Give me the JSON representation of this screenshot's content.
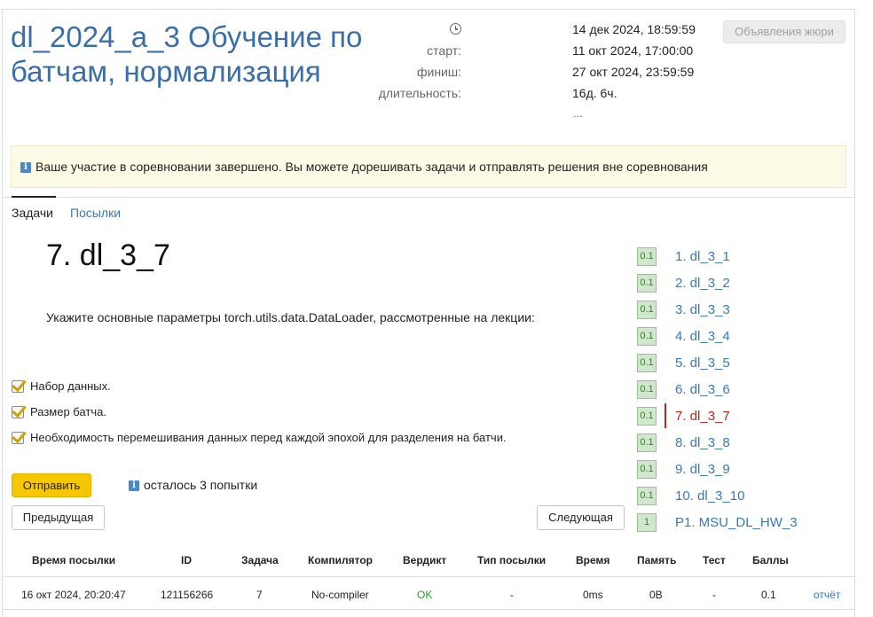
{
  "contest": {
    "title": "dl_2024_a_3 Обучение по батчам, нормализация",
    "jury_button": "Объявления жюри",
    "now": "14 дек 2024, 18:59:59",
    "start_label": "старт:",
    "start": "11 окт 2024, 17:00:00",
    "finish_label": "финиш:",
    "finish": "27 окт 2024, 23:59:59",
    "duration_label": "длительность:",
    "duration": "16д. 6ч.",
    "more": "..."
  },
  "notice": {
    "text": "Ваше участие в соревновании завершено. Вы можете дорешивать задачи и отправлять решения вне соревнования"
  },
  "tabs": [
    {
      "label": "Задачи",
      "active": true
    },
    {
      "label": "Посылки",
      "active": false
    }
  ],
  "problem": {
    "title": "7. dl_3_7",
    "statement": "Укажите основные параметры torch.utils.data.DataLoader, рассмотренные на лекции:",
    "options": [
      {
        "label": "Набор данных.",
        "checked": true
      },
      {
        "label": "Размер батча.",
        "checked": true
      },
      {
        "label": "Необходимость перемешивания данных перед каждой эпохой для разделения на батчи.",
        "checked": true
      }
    ],
    "submit_label": "Отправить",
    "attempts_text": "осталось 3 попытки",
    "prev_label": "Предыдущая",
    "next_label": "Следующая"
  },
  "tasks": [
    {
      "badge": "0.1",
      "label": "1. dl_3_1"
    },
    {
      "badge": "0.1",
      "label": "2. dl_3_2"
    },
    {
      "badge": "0.1",
      "label": "3. dl_3_3"
    },
    {
      "badge": "0.1",
      "label": "4. dl_3_4"
    },
    {
      "badge": "0.1",
      "label": "5. dl_3_5"
    },
    {
      "badge": "0.1",
      "label": "6. dl_3_6"
    },
    {
      "badge": "0.1",
      "label": "7. dl_3_7",
      "active": true
    },
    {
      "badge": "0.1",
      "label": "8. dl_3_8"
    },
    {
      "badge": "0.1",
      "label": "9. dl_3_9"
    },
    {
      "badge": "0.1",
      "label": "10. dl_3_10"
    },
    {
      "badge": "1",
      "label": "P1. MSU_DL_HW_3"
    }
  ],
  "submissions": {
    "headers": [
      "Время посылки",
      "ID",
      "Задача",
      "Компилятор",
      "Вердикт",
      "Тип посылки",
      "Время",
      "Память",
      "Тест",
      "Баллы"
    ],
    "rows": [
      [
        "16 окт 2024, 20:20:47",
        "121156266",
        "7",
        "No-compiler",
        "OK",
        "-",
        "0ms",
        "0B",
        "-",
        "0.1",
        "отчёт"
      ]
    ]
  },
  "colors": {
    "title": "#3a6ea8",
    "link": "#3a78b5",
    "active_task": "#b4281f",
    "submit_button": "#f6c600",
    "badge_bg": "#cfe7cb",
    "verdict_ok": "#2b9a2b",
    "notice_bg": "#fdfbe6"
  }
}
